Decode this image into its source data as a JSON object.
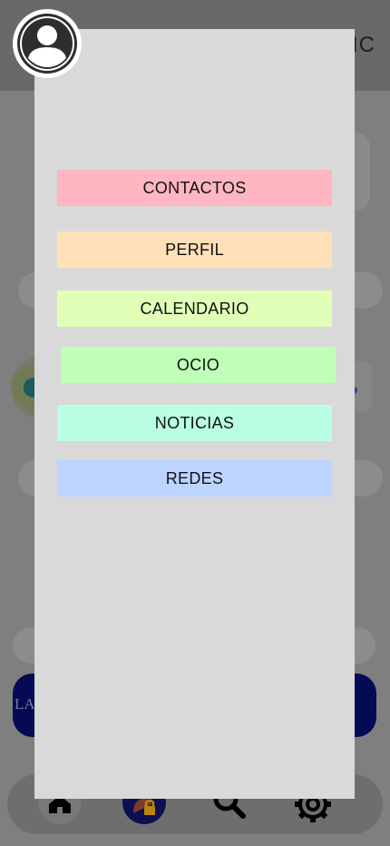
{
  "background": {
    "header_partial_text": "IC",
    "banner_partial_text": "LA"
  },
  "drawer": {
    "menu": [
      {
        "label": "CONTACTOS",
        "color": "#ffb6c1"
      },
      {
        "label": "PERFIL",
        "color": "#ffe0b8"
      },
      {
        "label": "CALENDARIO",
        "color": "#e2ffb8"
      },
      {
        "label": "OCIO",
        "color": "#c0ffb8"
      },
      {
        "label": "NOTICIAS",
        "color": "#b9ffe3"
      },
      {
        "label": "REDES",
        "color": "#bcd4ff"
      }
    ]
  },
  "icons": {
    "profile": "user-avatar-icon",
    "nav": [
      "home-icon",
      "lock-icon",
      "search-icon",
      "gear-icon"
    ]
  },
  "colors": {
    "drawer_bg": "#d9d9d9",
    "overlay_bg": "#808080"
  }
}
